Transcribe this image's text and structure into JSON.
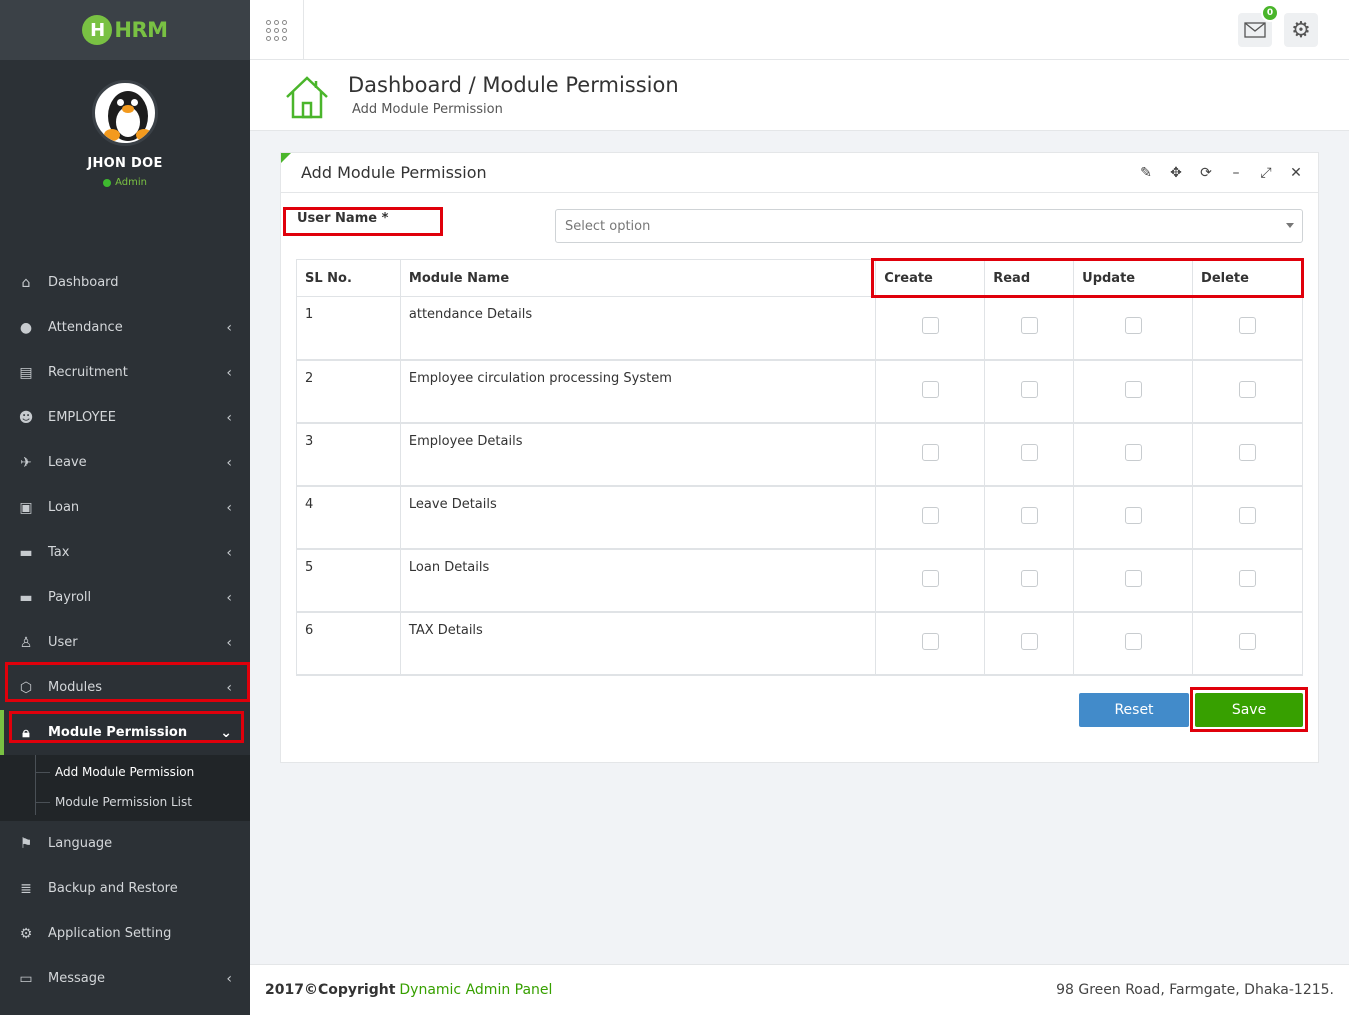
{
  "brand": {
    "logo_letter": "H",
    "logo_text": "HRM"
  },
  "user": {
    "name": "JHON DOE",
    "role": "Admin"
  },
  "menu": {
    "dashboard": "Dashboard",
    "attendance": "Attendance",
    "recruitment": "Recruitment",
    "employee": "EMPLOYEE",
    "leave": "Leave",
    "loan": "Loan",
    "tax": "Tax",
    "payroll": "Payroll",
    "user": "User",
    "modules": "Modules",
    "module_permission": "Module Permission",
    "sub_add": "Add Module Permission",
    "sub_list": "Module Permission List",
    "language": "Language",
    "backup": "Backup and Restore",
    "app_setting": "Application Setting",
    "message": "Message"
  },
  "topbar": {
    "notification_count": "0"
  },
  "header": {
    "title": "Dashboard / Module Permission",
    "subtitle": "Add Module Permission"
  },
  "panel": {
    "title": "Add Module Permission"
  },
  "form": {
    "user_label": "User Name *",
    "select_placeholder": "Select option"
  },
  "table": {
    "columns": [
      "SL No.",
      "Module Name",
      "Create",
      "Read",
      "Update",
      "Delete"
    ],
    "rows": [
      {
        "sl": "1",
        "module": "attendance Details"
      },
      {
        "sl": "2",
        "module": "Employee circulation processing System"
      },
      {
        "sl": "3",
        "module": "Employee Details"
      },
      {
        "sl": "4",
        "module": "Leave Details"
      },
      {
        "sl": "5",
        "module": "Loan Details"
      },
      {
        "sl": "6",
        "module": "TAX Details"
      }
    ]
  },
  "buttons": {
    "reset": "Reset",
    "save": "Save"
  },
  "footer": {
    "copyright": "2017©Copyright",
    "link": "Dynamic Admin Panel",
    "address": "98 Green Road, Farmgate, Dhaka-1215."
  },
  "colors": {
    "accent": "#79c143",
    "save": "#37a000",
    "reset": "#428bca",
    "highlight": "#e0000b",
    "sidebar": "#2c3136"
  }
}
